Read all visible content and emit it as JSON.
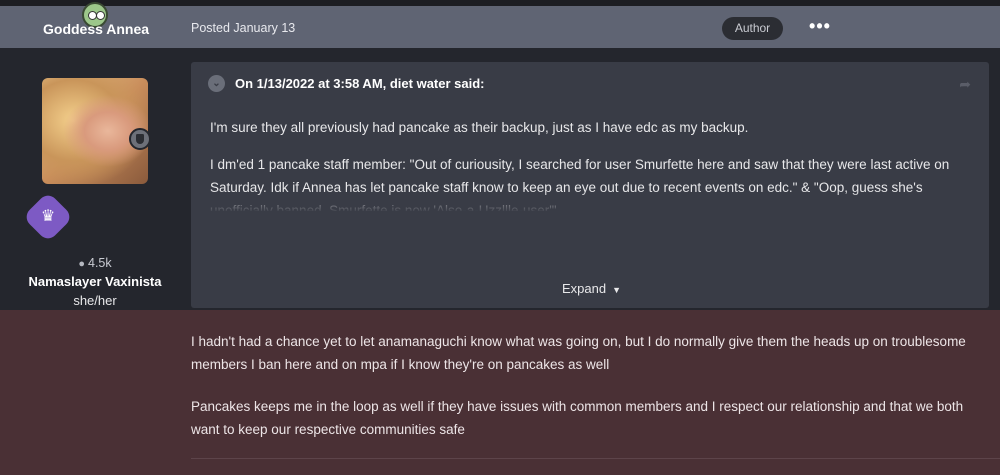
{
  "post": {
    "author_name": "Goddess Annea",
    "posted_date": "Posted January 13",
    "author_badge": "Author",
    "more_label": "•••"
  },
  "author_panel": {
    "reputation": "4.5k",
    "title": "Namaslayer Vaxinista",
    "pronouns": "she/her"
  },
  "quote": {
    "citation": "On 1/13/2022 at 3:58 AM, diet water said:",
    "paragraphs": [
      "I'm sure they all previously had pancake as their backup, just as I have edc as my backup.",
      "I dm'ed 1 pancake staff member: \"Out of curiousity, I searched for user Smurfette here and saw that they were last active on Saturday. Idk if Annea has let pancake staff know to keep an eye out due to recent events on edc.\" & \"Oop, guess she's unofficially banned. Smurfette is now 'Also-a-Uzzllle-user'\""
    ],
    "expand_label": "Expand"
  },
  "reply": {
    "paragraphs": [
      "I hadn't had a chance yet to let anamanaguchi know what was going on, but I do normally give them the heads up on troublesome members I ban here and on mpa if I know they're on pancakes as well",
      "Pancakes keeps me in the loop as well if they have issues with common members and I respect our relationship and that we both want to keep our respective communities safe"
    ]
  },
  "colors": {
    "header_bar": "#5f6473",
    "quote_bg": "#393c46",
    "highlight_bg": "#4a3035",
    "page_bg": "#24262d"
  }
}
